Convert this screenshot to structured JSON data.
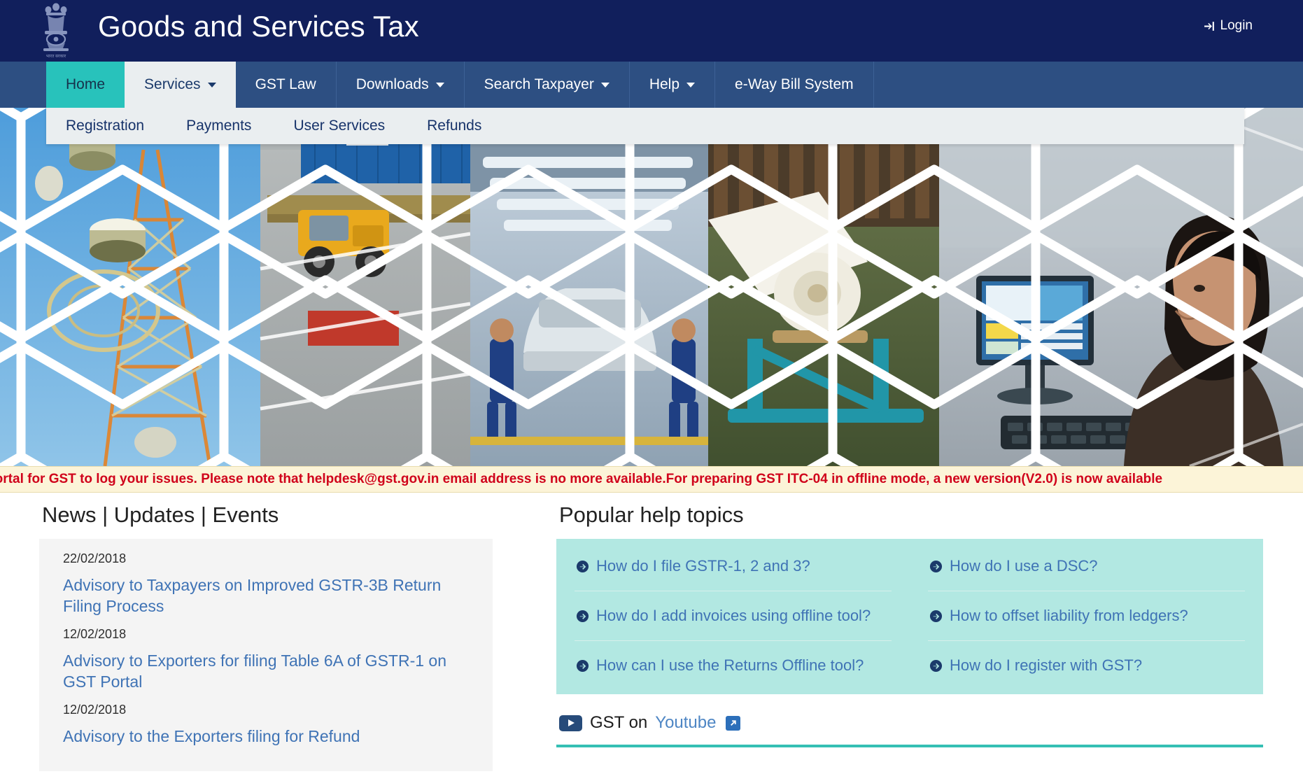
{
  "header": {
    "title": "Goods and Services Tax",
    "emblem_icon": "india-state-emblem-icon",
    "emblem_caption": "भारत सरकार",
    "login_label": "Login",
    "login_icon": "sign-in-icon",
    "bg_color": "#111f5c"
  },
  "nav": {
    "accent_active_color": "#28c2bb",
    "bg_color": "#2d4f82",
    "items": [
      {
        "label": "Home",
        "has_caret": false,
        "state": "active"
      },
      {
        "label": "Services",
        "has_caret": true,
        "state": "open"
      },
      {
        "label": "GST Law",
        "has_caret": false,
        "state": "default"
      },
      {
        "label": "Downloads",
        "has_caret": true,
        "state": "default"
      },
      {
        "label": "Search Taxpayer",
        "has_caret": true,
        "state": "default"
      },
      {
        "label": "Help",
        "has_caret": true,
        "state": "default"
      },
      {
        "label": "e-Way Bill System",
        "has_caret": false,
        "state": "default"
      }
    ]
  },
  "dropdown": {
    "parent": "Services",
    "bg_color": "#eaeef0",
    "items": [
      {
        "label": "Registration"
      },
      {
        "label": "Payments"
      },
      {
        "label": "User Services"
      },
      {
        "label": "Refunds"
      }
    ]
  },
  "hero": {
    "alt": "hexagonal collage of telecom tower, container truck, car assembly line, paper mill and woman at computer",
    "bg_color": "#6aa9d8"
  },
  "marquee": {
    "text": "Portal for GST to log your issues. Please note that helpdesk@gst.gov.in email address is no more available.For preparing GST ITC-04 in offline mode, a new version(V2.0) is now available",
    "text_color": "#d0021b",
    "bg_color": "#fcf4d8"
  },
  "news": {
    "title": "News | Updates | Events",
    "items": [
      {
        "date": "22/02/2018",
        "link": "Advisory to Taxpayers on Improved GSTR-3B Return Filing Process"
      },
      {
        "date": "12/02/2018",
        "link": "Advisory to Exporters for filing Table 6A of GSTR-1 on GST Portal"
      },
      {
        "date": "12/02/2018",
        "link": "Advisory to the Exporters filing for Refund"
      }
    ]
  },
  "help": {
    "title": "Popular help topics",
    "bg_color": "#b2e8e2",
    "rows": [
      [
        {
          "label": "How do I file GSTR-1, 2 and 3?",
          "icon": "arrow-circle-right-icon"
        },
        {
          "label": "How do I use a DSC?",
          "icon": "arrow-circle-right-icon"
        }
      ],
      [
        {
          "label": "How do I add invoices using offline tool?",
          "icon": "arrow-circle-right-icon"
        },
        {
          "label": "How to offset liability from ledgers?",
          "icon": "arrow-circle-right-icon"
        }
      ],
      [
        {
          "label": "How can I use the Returns Offline tool?",
          "icon": "arrow-circle-right-icon"
        },
        {
          "label": "How do I register with GST?",
          "icon": "arrow-circle-right-icon"
        }
      ]
    ]
  },
  "youtube": {
    "prefix": "GST on",
    "link_label": "Youtube",
    "play_icon": "youtube-play-icon",
    "external_icon": "external-link-icon",
    "rule_color": "#35bfb4"
  }
}
